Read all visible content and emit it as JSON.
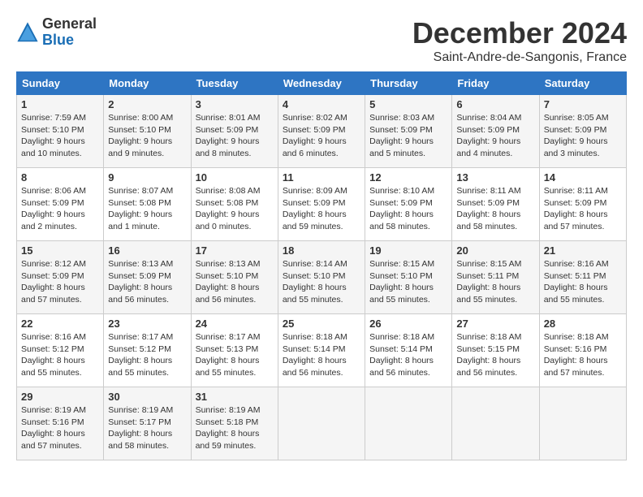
{
  "logo": {
    "general": "General",
    "blue": "Blue"
  },
  "title": "December 2024",
  "subtitle": "Saint-Andre-de-Sangonis, France",
  "days_of_week": [
    "Sunday",
    "Monday",
    "Tuesday",
    "Wednesday",
    "Thursday",
    "Friday",
    "Saturday"
  ],
  "weeks": [
    [
      {
        "day": 1,
        "sunrise": "Sunrise: 7:59 AM",
        "sunset": "Sunset: 5:10 PM",
        "daylight": "Daylight: 9 hours and 10 minutes."
      },
      {
        "day": 2,
        "sunrise": "Sunrise: 8:00 AM",
        "sunset": "Sunset: 5:10 PM",
        "daylight": "Daylight: 9 hours and 9 minutes."
      },
      {
        "day": 3,
        "sunrise": "Sunrise: 8:01 AM",
        "sunset": "Sunset: 5:09 PM",
        "daylight": "Daylight: 9 hours and 8 minutes."
      },
      {
        "day": 4,
        "sunrise": "Sunrise: 8:02 AM",
        "sunset": "Sunset: 5:09 PM",
        "daylight": "Daylight: 9 hours and 6 minutes."
      },
      {
        "day": 5,
        "sunrise": "Sunrise: 8:03 AM",
        "sunset": "Sunset: 5:09 PM",
        "daylight": "Daylight: 9 hours and 5 minutes."
      },
      {
        "day": 6,
        "sunrise": "Sunrise: 8:04 AM",
        "sunset": "Sunset: 5:09 PM",
        "daylight": "Daylight: 9 hours and 4 minutes."
      },
      {
        "day": 7,
        "sunrise": "Sunrise: 8:05 AM",
        "sunset": "Sunset: 5:09 PM",
        "daylight": "Daylight: 9 hours and 3 minutes."
      }
    ],
    [
      {
        "day": 8,
        "sunrise": "Sunrise: 8:06 AM",
        "sunset": "Sunset: 5:09 PM",
        "daylight": "Daylight: 9 hours and 2 minutes."
      },
      {
        "day": 9,
        "sunrise": "Sunrise: 8:07 AM",
        "sunset": "Sunset: 5:08 PM",
        "daylight": "Daylight: 9 hours and 1 minute."
      },
      {
        "day": 10,
        "sunrise": "Sunrise: 8:08 AM",
        "sunset": "Sunset: 5:08 PM",
        "daylight": "Daylight: 9 hours and 0 minutes."
      },
      {
        "day": 11,
        "sunrise": "Sunrise: 8:09 AM",
        "sunset": "Sunset: 5:09 PM",
        "daylight": "Daylight: 8 hours and 59 minutes."
      },
      {
        "day": 12,
        "sunrise": "Sunrise: 8:10 AM",
        "sunset": "Sunset: 5:09 PM",
        "daylight": "Daylight: 8 hours and 58 minutes."
      },
      {
        "day": 13,
        "sunrise": "Sunrise: 8:11 AM",
        "sunset": "Sunset: 5:09 PM",
        "daylight": "Daylight: 8 hours and 58 minutes."
      },
      {
        "day": 14,
        "sunrise": "Sunrise: 8:11 AM",
        "sunset": "Sunset: 5:09 PM",
        "daylight": "Daylight: 8 hours and 57 minutes."
      }
    ],
    [
      {
        "day": 15,
        "sunrise": "Sunrise: 8:12 AM",
        "sunset": "Sunset: 5:09 PM",
        "daylight": "Daylight: 8 hours and 57 minutes."
      },
      {
        "day": 16,
        "sunrise": "Sunrise: 8:13 AM",
        "sunset": "Sunset: 5:09 PM",
        "daylight": "Daylight: 8 hours and 56 minutes."
      },
      {
        "day": 17,
        "sunrise": "Sunrise: 8:13 AM",
        "sunset": "Sunset: 5:10 PM",
        "daylight": "Daylight: 8 hours and 56 minutes."
      },
      {
        "day": 18,
        "sunrise": "Sunrise: 8:14 AM",
        "sunset": "Sunset: 5:10 PM",
        "daylight": "Daylight: 8 hours and 55 minutes."
      },
      {
        "day": 19,
        "sunrise": "Sunrise: 8:15 AM",
        "sunset": "Sunset: 5:10 PM",
        "daylight": "Daylight: 8 hours and 55 minutes."
      },
      {
        "day": 20,
        "sunrise": "Sunrise: 8:15 AM",
        "sunset": "Sunset: 5:11 PM",
        "daylight": "Daylight: 8 hours and 55 minutes."
      },
      {
        "day": 21,
        "sunrise": "Sunrise: 8:16 AM",
        "sunset": "Sunset: 5:11 PM",
        "daylight": "Daylight: 8 hours and 55 minutes."
      }
    ],
    [
      {
        "day": 22,
        "sunrise": "Sunrise: 8:16 AM",
        "sunset": "Sunset: 5:12 PM",
        "daylight": "Daylight: 8 hours and 55 minutes."
      },
      {
        "day": 23,
        "sunrise": "Sunrise: 8:17 AM",
        "sunset": "Sunset: 5:12 PM",
        "daylight": "Daylight: 8 hours and 55 minutes."
      },
      {
        "day": 24,
        "sunrise": "Sunrise: 8:17 AM",
        "sunset": "Sunset: 5:13 PM",
        "daylight": "Daylight: 8 hours and 55 minutes."
      },
      {
        "day": 25,
        "sunrise": "Sunrise: 8:18 AM",
        "sunset": "Sunset: 5:14 PM",
        "daylight": "Daylight: 8 hours and 56 minutes."
      },
      {
        "day": 26,
        "sunrise": "Sunrise: 8:18 AM",
        "sunset": "Sunset: 5:14 PM",
        "daylight": "Daylight: 8 hours and 56 minutes."
      },
      {
        "day": 27,
        "sunrise": "Sunrise: 8:18 AM",
        "sunset": "Sunset: 5:15 PM",
        "daylight": "Daylight: 8 hours and 56 minutes."
      },
      {
        "day": 28,
        "sunrise": "Sunrise: 8:18 AM",
        "sunset": "Sunset: 5:16 PM",
        "daylight": "Daylight: 8 hours and 57 minutes."
      }
    ],
    [
      {
        "day": 29,
        "sunrise": "Sunrise: 8:19 AM",
        "sunset": "Sunset: 5:16 PM",
        "daylight": "Daylight: 8 hours and 57 minutes."
      },
      {
        "day": 30,
        "sunrise": "Sunrise: 8:19 AM",
        "sunset": "Sunset: 5:17 PM",
        "daylight": "Daylight: 8 hours and 58 minutes."
      },
      {
        "day": 31,
        "sunrise": "Sunrise: 8:19 AM",
        "sunset": "Sunset: 5:18 PM",
        "daylight": "Daylight: 8 hours and 59 minutes."
      },
      null,
      null,
      null,
      null
    ]
  ]
}
